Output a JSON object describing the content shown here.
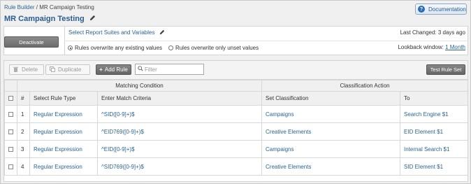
{
  "breadcrumb": {
    "root": "Rule Builder",
    "separator": " / ",
    "current": "MR Campaign Testing"
  },
  "header": {
    "title": "MR Campaign Testing",
    "documentation_label": "Documentation"
  },
  "panel": {
    "deactivate_label": "Deactivate",
    "select_link": "Select Report Suites and Variables",
    "last_changed": "Last Changed: 3 days ago",
    "radio_overwrite_all": "Rules overwrite any existing values",
    "radio_overwrite_unset": "Rules overwrite only unset values",
    "lookback_label": "Lookback window:",
    "lookback_value": "1 Month"
  },
  "toolbar": {
    "delete_label": "Delete",
    "duplicate_label": "Duplicate",
    "add_rule_label": "Add Rule",
    "filter_placeholder": "Filter",
    "test_label": "Test Rule Set"
  },
  "table": {
    "group_matching": "Matching Condition",
    "group_classification": "Classification Action",
    "headers": [
      "#",
      "Select Rule Type",
      "Enter Match Criteria",
      "Set Classification",
      "To"
    ],
    "rows": [
      {
        "num": "1",
        "type": "Regular Expression",
        "criteria": "^SID([0-9]+)$",
        "classification": "Campaigns",
        "to": "Search Engine $1"
      },
      {
        "num": "2",
        "type": "Regular Expression",
        "criteria": "^EID769([0-9]+)$",
        "classification": "Creative Elements",
        "to": "EID Element $1"
      },
      {
        "num": "3",
        "type": "Regular Expression",
        "criteria": "^EID([0-9]+)$",
        "classification": "Campaigns",
        "to": "Internal Search $1"
      },
      {
        "num": "4",
        "type": "Regular Expression",
        "criteria": "^SID769([0-9]+)$",
        "classification": "Creative Elements",
        "to": "SID Element $1"
      }
    ]
  }
}
